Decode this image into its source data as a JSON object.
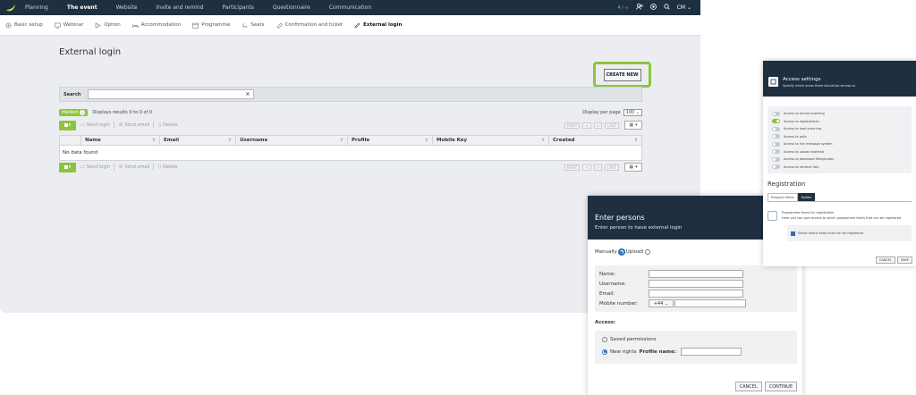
{
  "topnav": {
    "items": [
      "Planning",
      "The event",
      "Website",
      "Invite and remind",
      "Participants",
      "Questionnaire",
      "Communication"
    ],
    "counter": "4 / ∞",
    "user": "CM"
  },
  "subnav": {
    "items": [
      "Basic setup",
      "Webinar",
      "Option",
      "Accommodation",
      "Programme",
      "Seats",
      "Confirmation and ticket",
      "External login"
    ]
  },
  "page": {
    "title": "External login",
    "create_new": "CREATE NEW",
    "search_label": "Search",
    "marked_label": "Marked",
    "marked_count": "0",
    "display_text": "Displays results 0 to 0 of 0",
    "per_page_label": "Display per page",
    "per_page_value": "100",
    "send_login": "Send login",
    "send_email": "Send email",
    "delete": "Delete",
    "pager": [
      "FIRST",
      "<",
      ">",
      "LAST"
    ],
    "columns": [
      "Name",
      "Email",
      "Username",
      "Profile",
      "Mobile Key",
      "Created"
    ],
    "empty": "No data found"
  },
  "enter_persons": {
    "title": "Enter persons",
    "subtitle": "Enter person to have external login",
    "manually": "Manually",
    "upload": "Upload",
    "name": "Name:",
    "username": "Username:",
    "email": "Email:",
    "mobile": "Mobile number:",
    "country_code": "+44",
    "access": "Access:",
    "saved_permissions": "Saved permissions",
    "new_rights": "New rights",
    "profile_name": "Profile name:",
    "cancel": "CANCEL",
    "continue": "CONTINUE"
  },
  "access_settings": {
    "title": "Access settings",
    "subtitle": "Specify which areas there should be access to",
    "toggles": [
      {
        "label": "Access to arrival scanning",
        "on": false
      },
      {
        "label": "Access to registrations",
        "on": true
      },
      {
        "label": "Access to lead scanning",
        "on": false
      },
      {
        "label": "Access to polls",
        "on": false
      },
      {
        "label": "Access to live message system",
        "on": false
      },
      {
        "label": "Access to upload material",
        "on": false
      },
      {
        "label": "Access to download files/photos",
        "on": false
      },
      {
        "label": "Access to retrieve lists",
        "on": false
      }
    ],
    "registration": "Registration",
    "tabs": [
      "Program items",
      "Option"
    ],
    "reg_line1": "Programme items for registration",
    "reg_line2": "Here you can give access to which programme items that can be registered",
    "reg_check": "Select which items that can be registered",
    "cancel": "CANCEL",
    "save": "SAVE"
  }
}
